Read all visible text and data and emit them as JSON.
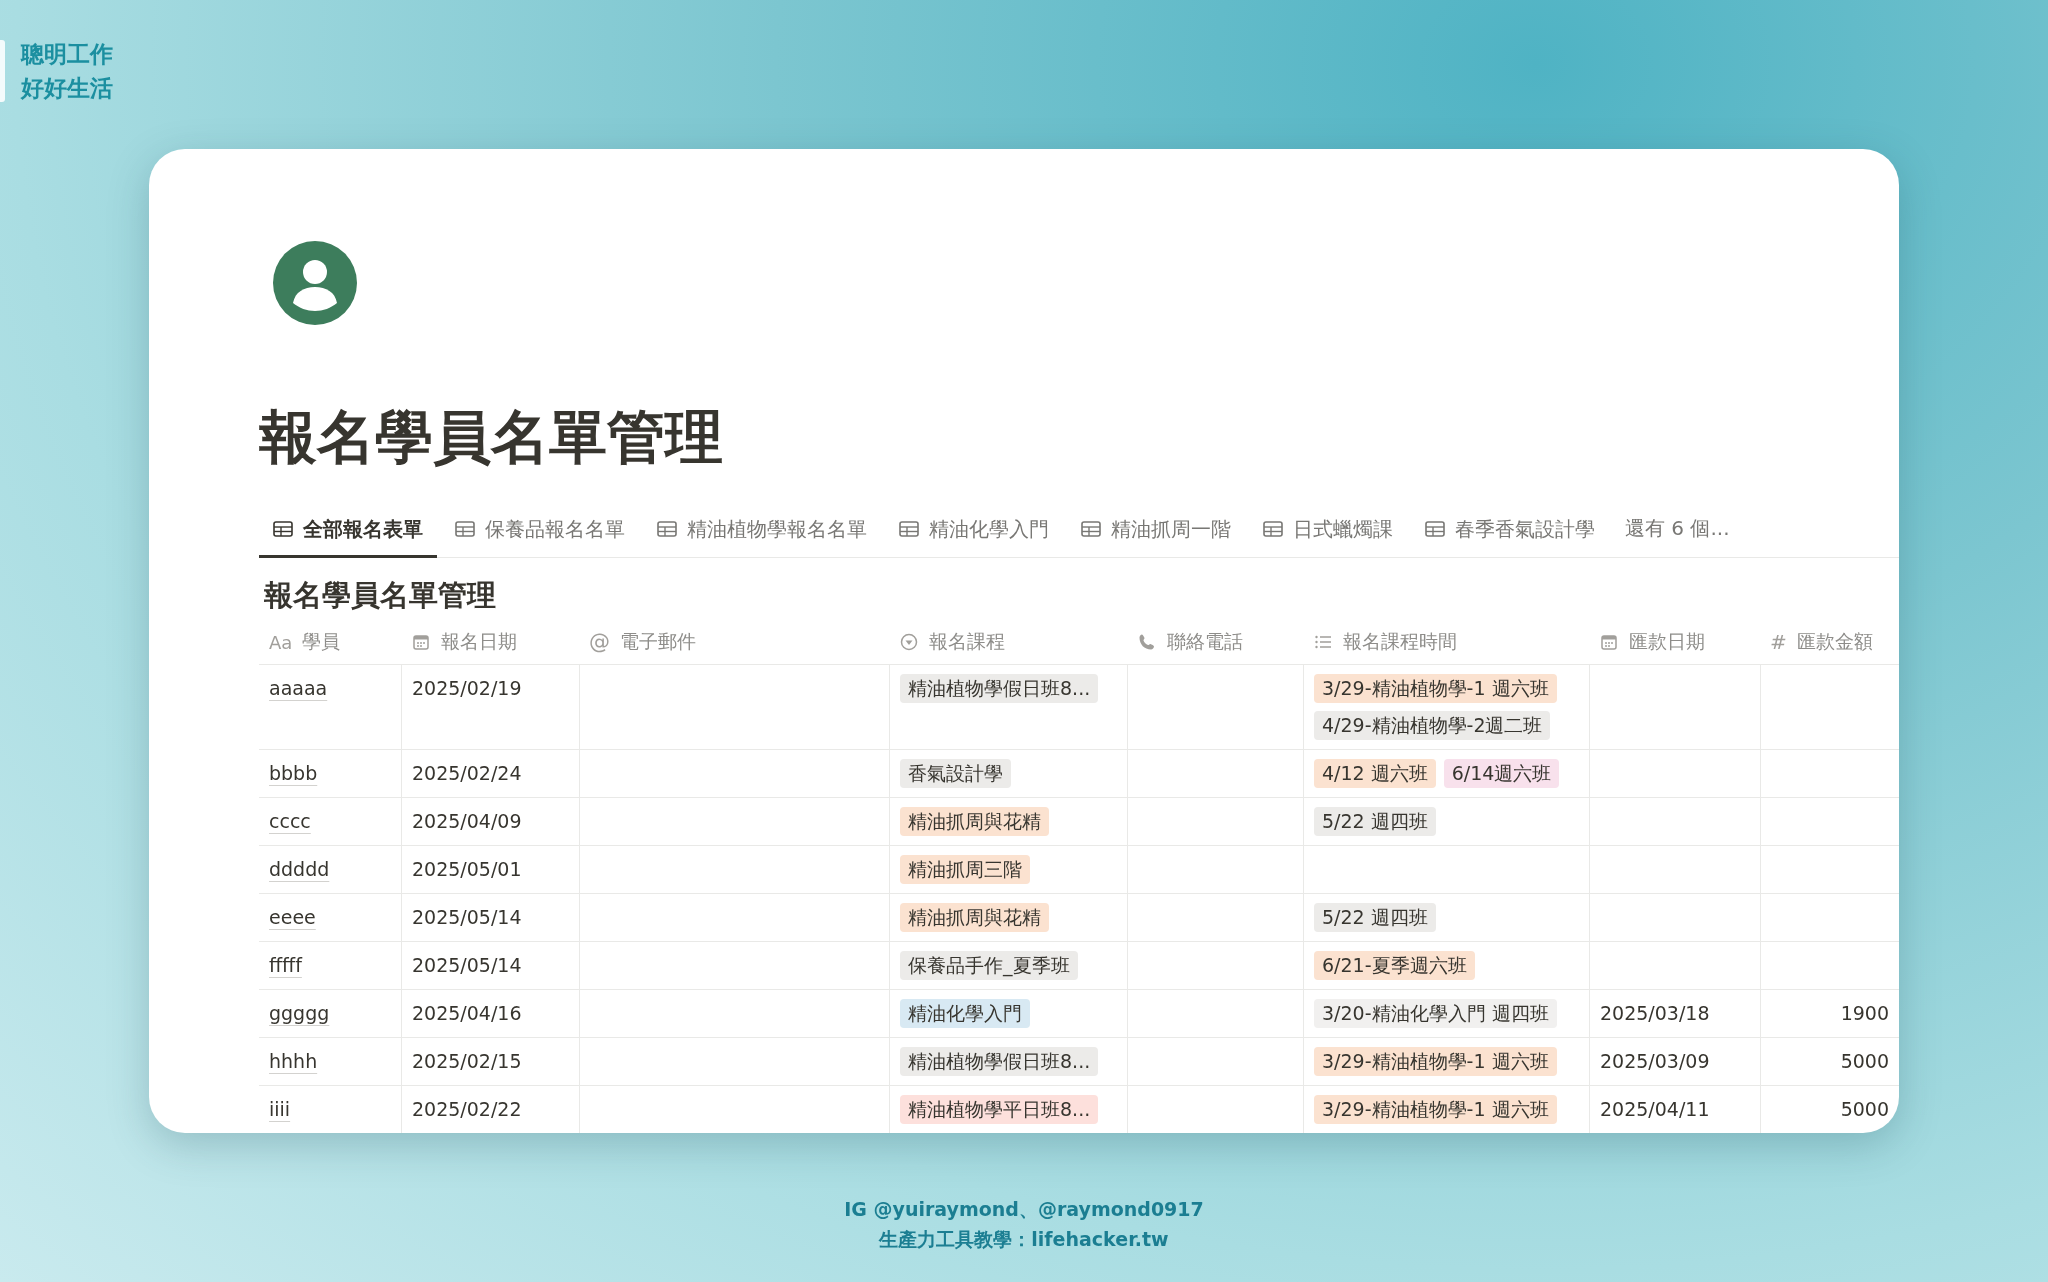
{
  "brand": {
    "lines": [
      "聰明工作",
      "好好生活"
    ]
  },
  "page": {
    "title": "報名學員名單管理",
    "tabs": [
      {
        "label": "全部報名表單",
        "selected": true
      },
      {
        "label": "保養品報名名單",
        "selected": false
      },
      {
        "label": "精油植物學報名名單",
        "selected": false
      },
      {
        "label": "精油化學入門",
        "selected": false
      },
      {
        "label": "精油抓周一階",
        "selected": false
      },
      {
        "label": "日式蠟燭課",
        "selected": false
      },
      {
        "label": "春季香氣設計學",
        "selected": false
      }
    ],
    "more_tabs": "還有 6 個...",
    "table": {
      "title": "報名學員名單管理",
      "columns": [
        {
          "kind": "title",
          "icon_text": "Aa",
          "label": "學員"
        },
        {
          "kind": "date",
          "label": "報名日期"
        },
        {
          "kind": "email",
          "icon_text": "@",
          "label": "電子郵件"
        },
        {
          "kind": "select",
          "label": "報名課程"
        },
        {
          "kind": "phone",
          "label": "聯絡電話"
        },
        {
          "kind": "multiselect",
          "label": "報名課程時間"
        },
        {
          "kind": "date",
          "label": "匯款日期"
        },
        {
          "kind": "number",
          "icon_text": "#",
          "label": "匯款金額"
        }
      ],
      "rows": [
        {
          "name": "aaaaa",
          "date": "2025/02/19",
          "course": [
            {
              "label": "精油植物學假日班8...",
              "color": "#ecebe9"
            }
          ],
          "times": [
            {
              "label": "3/29-精油植物學-1 週六班",
              "color": "#fbe2d0"
            },
            {
              "label": "4/29-精油植物學-2週二班",
              "color": "#ecebe9"
            }
          ]
        },
        {
          "name": "bbbb",
          "date": "2025/02/24",
          "course": [
            {
              "label": "香氣設計學",
              "color": "#ecebe9"
            }
          ],
          "times": [
            {
              "label": "4/12 週六班",
              "color": "#fbe2d0"
            },
            {
              "label": "6/14週六班",
              "color": "#f8e1ec"
            }
          ]
        },
        {
          "name": "cccc",
          "date": "2025/04/09",
          "course": [
            {
              "label": "精油抓周與花精",
              "color": "#fbe2d0"
            }
          ],
          "times": [
            {
              "label": "5/22 週四班",
              "color": "#ecebe9"
            }
          ]
        },
        {
          "name": "ddddd",
          "date": "2025/05/01",
          "course": [
            {
              "label": "精油抓周三階",
              "color": "#fbe2d0"
            }
          ],
          "times": []
        },
        {
          "name": "eeee",
          "date": "2025/05/14",
          "course": [
            {
              "label": "精油抓周與花精",
              "color": "#fbe2d0"
            }
          ],
          "times": [
            {
              "label": "5/22 週四班",
              "color": "#ecebe9"
            }
          ]
        },
        {
          "name": "fffff",
          "date": "2025/05/14",
          "course": [
            {
              "label": "保養品手作_夏季班",
              "color": "#ecebe9"
            }
          ],
          "times": [
            {
              "label": "6/21-夏季週六班",
              "color": "#fbe2d0"
            }
          ]
        },
        {
          "name": "ggggg",
          "date": "2025/04/16",
          "course": [
            {
              "label": "精油化學入門",
              "color": "#d8e9f3"
            }
          ],
          "times": [
            {
              "label": "3/20-精油化學入門 週四班",
              "color": "#f1f0ef"
            }
          ],
          "pay_date": "2025/03/18",
          "amount": "1900"
        },
        {
          "name": "hhhh",
          "date": "2025/02/15",
          "course": [
            {
              "label": "精油植物學假日班8...",
              "color": "#ecebe9"
            }
          ],
          "times": [
            {
              "label": "3/29-精油植物學-1 週六班",
              "color": "#fbe2d0"
            }
          ],
          "pay_date": "2025/03/09",
          "amount": "5000"
        },
        {
          "name": "iiii",
          "date": "2025/02/22",
          "course": [
            {
              "label": "精油植物學平日班8...",
              "color": "#fde0dc"
            }
          ],
          "times": [
            {
              "label": "3/29-精油植物學-1 週六班",
              "color": "#fbe2d0"
            }
          ],
          "pay_date": "2025/04/11",
          "amount": "5000"
        }
      ]
    }
  },
  "footer": {
    "lines": [
      "IG @yuiraymond、@raymond0917",
      "生產力工具教學：lifehacker.tw"
    ]
  }
}
